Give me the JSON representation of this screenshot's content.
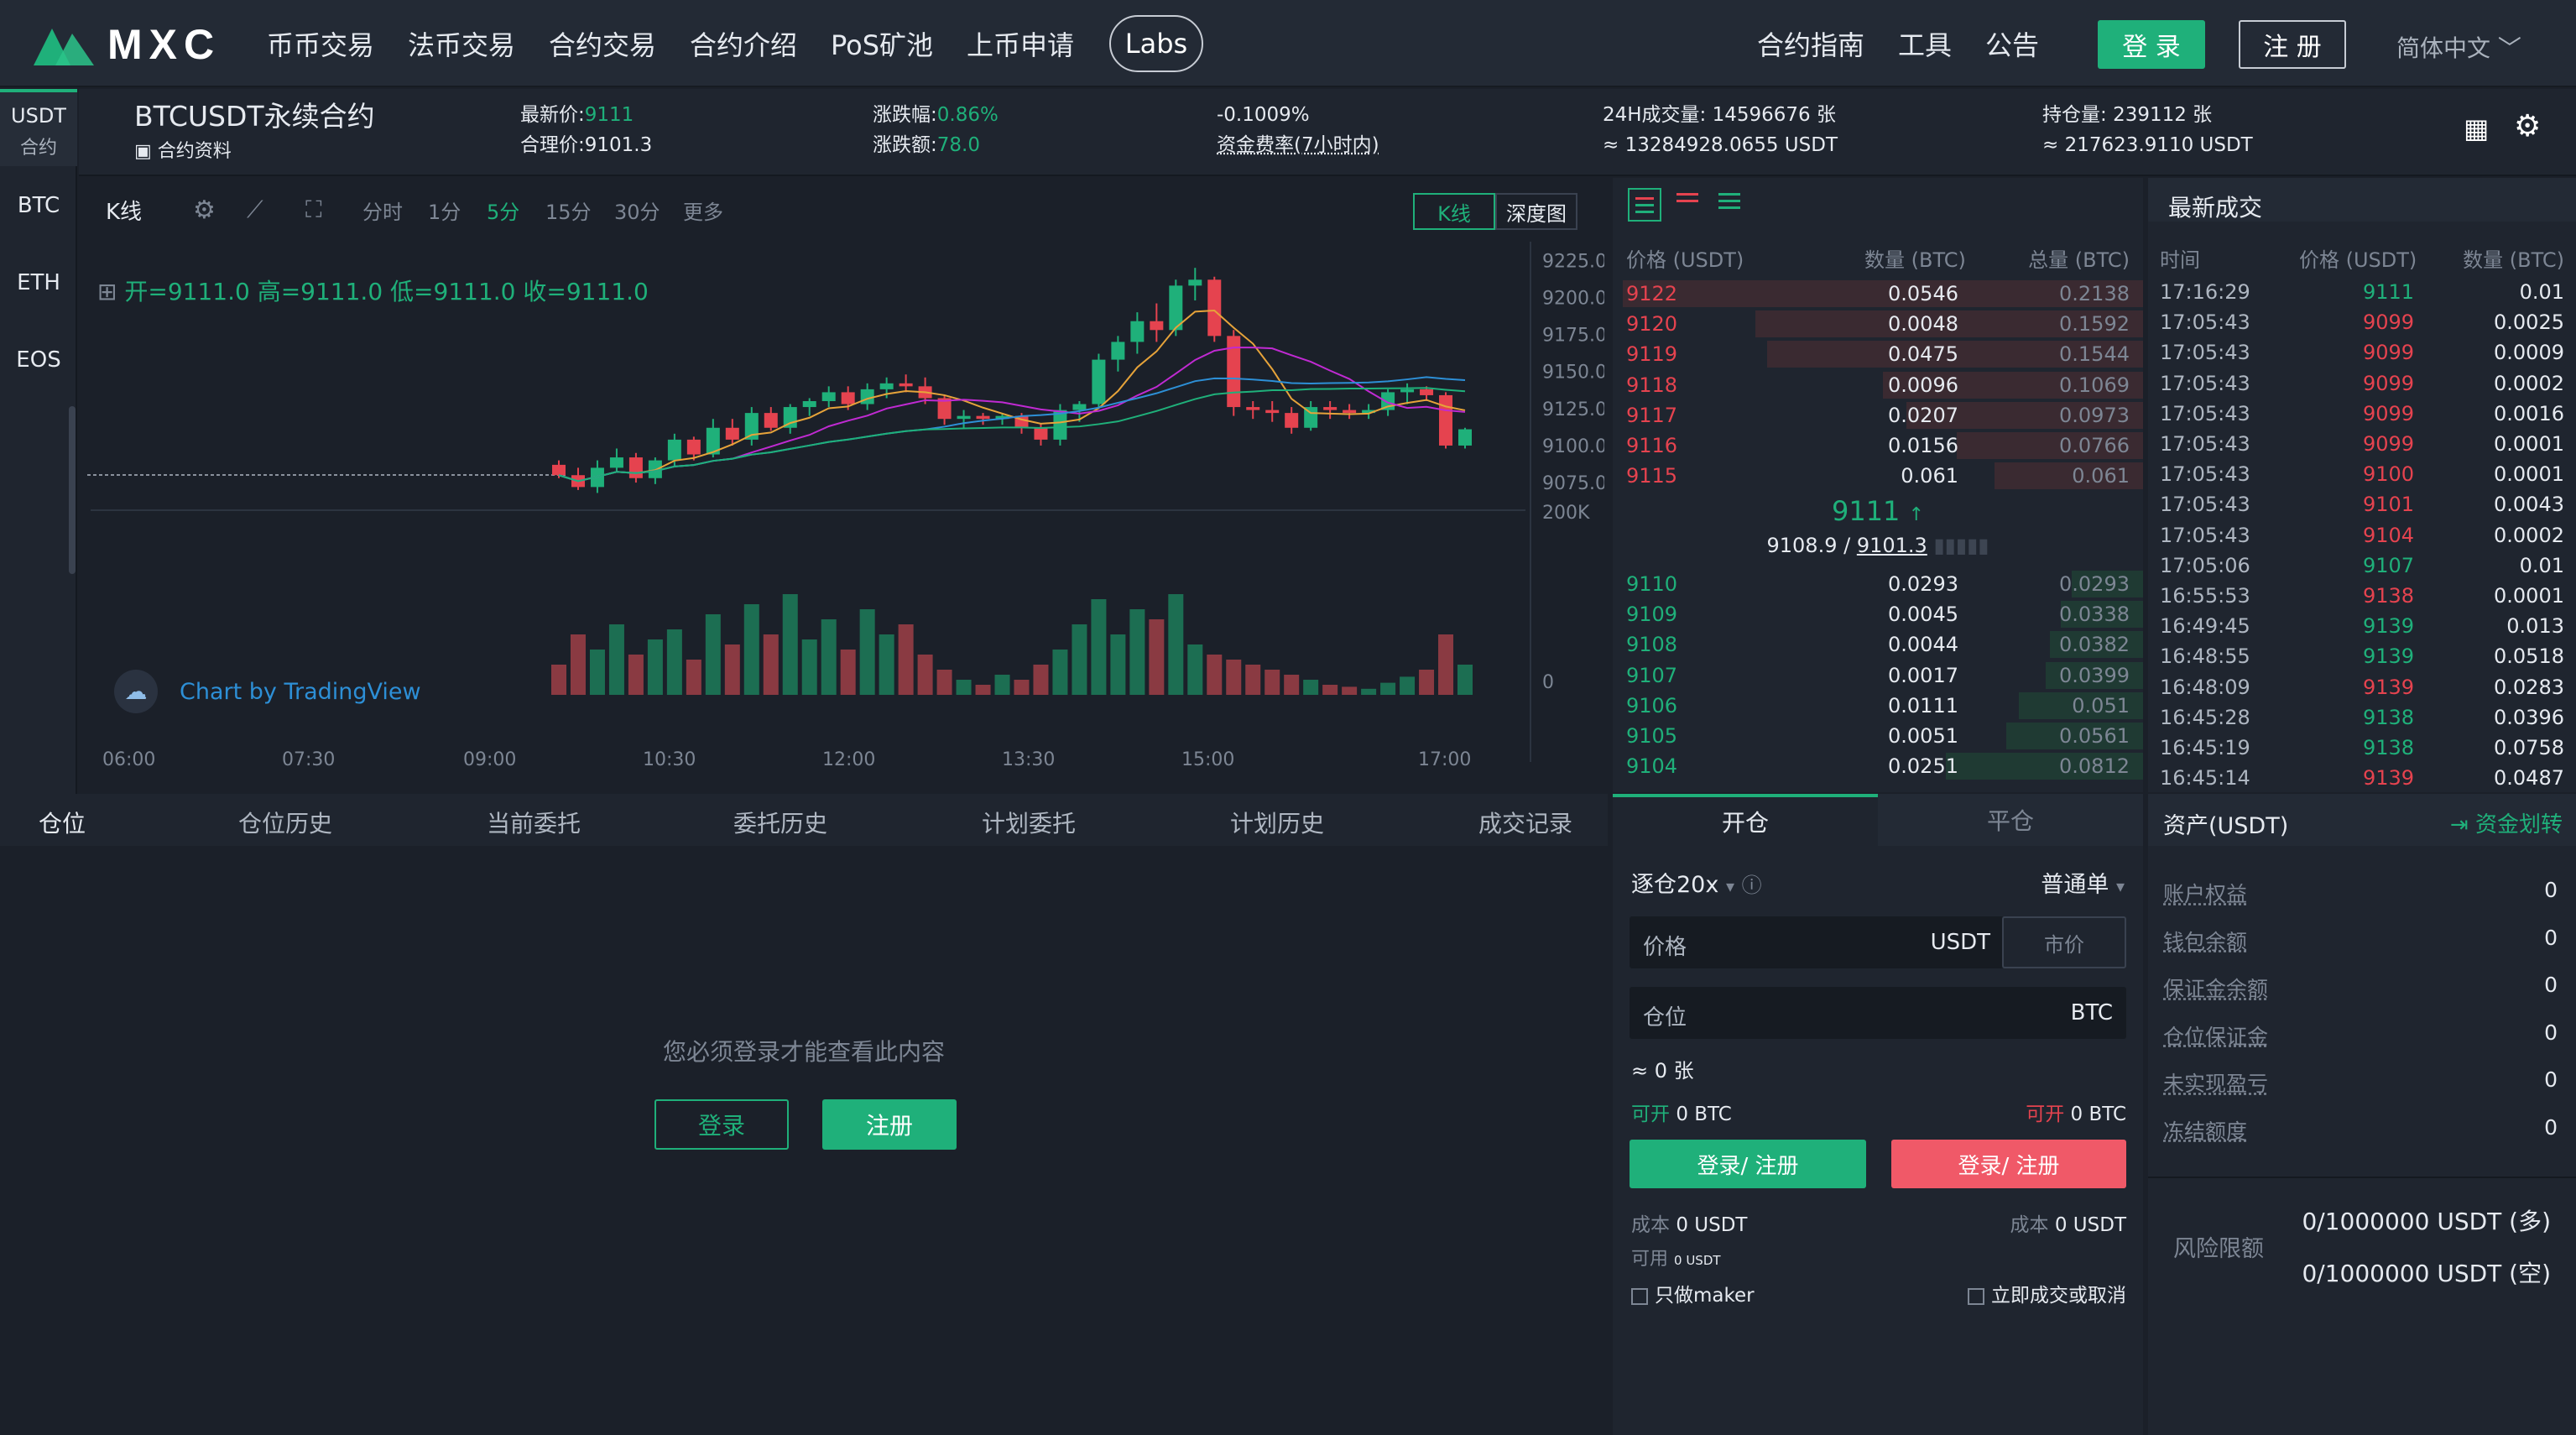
{
  "brand": {
    "name": "MXC",
    "logo_color": "#1fb07a"
  },
  "nav": {
    "items": [
      "币币交易",
      "法币交易",
      "合约交易",
      "合约介绍",
      "PoS矿池",
      "上币申请"
    ],
    "labs": "Labs",
    "right_items": [
      "合约指南",
      "工具",
      "公告"
    ],
    "login": "登 录",
    "register": "注 册",
    "language": "简体中文"
  },
  "sidebar": {
    "header_line1": "USDT",
    "header_line2": "合约",
    "coins": [
      "BTC",
      "ETH",
      "EOS"
    ],
    "active": "BTC"
  },
  "ticker": {
    "symbol": "BTCUSDT永续合约",
    "info_link": "合约资料",
    "last_price_label": "最新价:",
    "last_price": "9111",
    "fair_price_label": "合理价:",
    "fair_price": "9101.3",
    "change_pct_label": "涨跌幅:",
    "change_pct": "0.86%",
    "change_amt_label": "涨跌额:",
    "change_amt": "78.0",
    "funding_rate": "-0.1009%",
    "funding_label": "资金费率(7小时内)",
    "volume_label": "24H成交量:",
    "volume": "14596676 张",
    "volume_usdt": "≈ 13284928.0655 USDT",
    "open_interest_label": "持仓量:",
    "open_interest": "239112 张",
    "open_interest_usdt": "≈ 217623.9110 USDT"
  },
  "chart_toolbar": {
    "title": "K线",
    "intervals": [
      "分时",
      "1分",
      "5分",
      "15分",
      "30分",
      "更多"
    ],
    "active_interval": "5分",
    "view_kline": "K线",
    "view_depth": "深度图"
  },
  "chart_data": {
    "type": "candlestick",
    "ohlc_legend": "开=9111.0  高=9111.0  低=9111.0  收=9111.0",
    "watermark": "Chart by TradingView",
    "y_ticks": [
      "9225.0",
      "9200.0",
      "9175.0",
      "9150.0",
      "9125.0",
      "9100.0",
      "9075.0"
    ],
    "ylim": [
      9062,
      9232
    ],
    "volume_ticks": [
      "200K",
      "0"
    ],
    "x_ticks": [
      "06:00",
      "07:30",
      "09:00",
      "10:30",
      "12:00",
      "13:30",
      "15:00",
      "17:00"
    ],
    "candles": [
      [
        9087,
        9090,
        9078,
        9080
      ],
      [
        9080,
        9085,
        9070,
        9072
      ],
      [
        9072,
        9090,
        9068,
        9085
      ],
      [
        9085,
        9098,
        9082,
        9092
      ],
      [
        9092,
        9095,
        9075,
        9078
      ],
      [
        9078,
        9092,
        9074,
        9090
      ],
      [
        9090,
        9108,
        9086,
        9104
      ],
      [
        9104,
        9106,
        9090,
        9094
      ],
      [
        9094,
        9118,
        9092,
        9112
      ],
      [
        9112,
        9118,
        9100,
        9104
      ],
      [
        9104,
        9126,
        9100,
        9122
      ],
      [
        9122,
        9126,
        9110,
        9112
      ],
      [
        9112,
        9128,
        9108,
        9126
      ],
      [
        9126,
        9132,
        9120,
        9130
      ],
      [
        9130,
        9140,
        9126,
        9136
      ],
      [
        9136,
        9140,
        9124,
        9128
      ],
      [
        9128,
        9142,
        9124,
        9138
      ],
      [
        9138,
        9146,
        9132,
        9142
      ],
      [
        9142,
        9148,
        9136,
        9140
      ],
      [
        9140,
        9146,
        9128,
        9132
      ],
      [
        9132,
        9134,
        9114,
        9118
      ],
      [
        9118,
        9124,
        9112,
        9120
      ],
      [
        9120,
        9122,
        9114,
        9118
      ],
      [
        9118,
        9122,
        9114,
        9120
      ],
      [
        9120,
        9122,
        9108,
        9112
      ],
      [
        9112,
        9115,
        9100,
        9104
      ],
      [
        9104,
        9128,
        9100,
        9124
      ],
      [
        9124,
        9130,
        9116,
        9128
      ],
      [
        9128,
        9162,
        9126,
        9158
      ],
      [
        9158,
        9174,
        9150,
        9170
      ],
      [
        9170,
        9190,
        9162,
        9184
      ],
      [
        9184,
        9196,
        9170,
        9178
      ],
      [
        9178,
        9212,
        9174,
        9208
      ],
      [
        9208,
        9220,
        9198,
        9212
      ],
      [
        9212,
        9214,
        9170,
        9174
      ],
      [
        9174,
        9178,
        9120,
        9126
      ],
      [
        9126,
        9130,
        9118,
        9124
      ],
      [
        9124,
        9130,
        9116,
        9122
      ],
      [
        9122,
        9126,
        9108,
        9112
      ],
      [
        9112,
        9130,
        9110,
        9126
      ],
      [
        9126,
        9130,
        9118,
        9124
      ],
      [
        9124,
        9128,
        9118,
        9122
      ],
      [
        9122,
        9128,
        9118,
        9124
      ],
      [
        9124,
        9138,
        9120,
        9136
      ],
      [
        9136,
        9142,
        9128,
        9138
      ],
      [
        9138,
        9140,
        9130,
        9134
      ],
      [
        9134,
        9136,
        9098,
        9100
      ],
      [
        9100,
        9112,
        9098,
        9111
      ]
    ],
    "volumes": [
      30,
      60,
      45,
      70,
      40,
      55,
      65,
      35,
      80,
      50,
      90,
      60,
      100,
      55,
      75,
      45,
      85,
      60,
      70,
      40,
      25,
      15,
      10,
      20,
      15,
      30,
      45,
      70,
      95,
      60,
      85,
      75,
      100,
      50,
      40,
      35,
      30,
      25,
      20,
      15,
      10,
      8,
      6,
      12,
      18,
      25,
      60,
      30
    ],
    "ma_colors": [
      "#e6a33a",
      "#c02ad2",
      "#2d8fd6",
      "#1fb07a"
    ]
  },
  "orderbook": {
    "headers": [
      "价格 (USDT)",
      "数量 (BTC)",
      "总量 (BTC)"
    ],
    "asks": [
      [
        "9122",
        "0.0546",
        "0.2138"
      ],
      [
        "9120",
        "0.0048",
        "0.1592"
      ],
      [
        "9119",
        "0.0475",
        "0.1544"
      ],
      [
        "9118",
        "0.0096",
        "0.1069"
      ],
      [
        "9117",
        "0.0207",
        "0.0973"
      ],
      [
        "9116",
        "0.0156",
        "0.0766"
      ],
      [
        "9115",
        "0.061",
        "0.061"
      ]
    ],
    "mid_price": "9111",
    "mid_index": "9108.9",
    "mid_fair": "9101.3",
    "bids": [
      [
        "9110",
        "0.0293",
        "0.0293"
      ],
      [
        "9109",
        "0.0045",
        "0.0338"
      ],
      [
        "9108",
        "0.0044",
        "0.0382"
      ],
      [
        "9107",
        "0.0017",
        "0.0399"
      ],
      [
        "9106",
        "0.0111",
        "0.051"
      ],
      [
        "9105",
        "0.0051",
        "0.0561"
      ],
      [
        "9104",
        "0.0251",
        "0.0812"
      ]
    ]
  },
  "trades": {
    "title": "最新成交",
    "headers": [
      "时间",
      "价格 (USDT)",
      "数量 (BTC)"
    ],
    "rows": [
      [
        "17:16:29",
        "9111",
        "0.01",
        "g"
      ],
      [
        "17:05:43",
        "9099",
        "0.0025",
        "r"
      ],
      [
        "17:05:43",
        "9099",
        "0.0009",
        "r"
      ],
      [
        "17:05:43",
        "9099",
        "0.0002",
        "r"
      ],
      [
        "17:05:43",
        "9099",
        "0.0016",
        "r"
      ],
      [
        "17:05:43",
        "9099",
        "0.0001",
        "r"
      ],
      [
        "17:05:43",
        "9100",
        "0.0001",
        "r"
      ],
      [
        "17:05:43",
        "9101",
        "0.0043",
        "r"
      ],
      [
        "17:05:43",
        "9104",
        "0.0002",
        "r"
      ],
      [
        "17:05:06",
        "9107",
        "0.01",
        "g"
      ],
      [
        "16:55:53",
        "9138",
        "0.0001",
        "r"
      ],
      [
        "16:49:45",
        "9139",
        "0.013",
        "g"
      ],
      [
        "16:48:55",
        "9139",
        "0.0518",
        "g"
      ],
      [
        "16:48:09",
        "9139",
        "0.0283",
        "r"
      ],
      [
        "16:45:28",
        "9138",
        "0.0396",
        "g"
      ],
      [
        "16:45:19",
        "9138",
        "0.0758",
        "g"
      ],
      [
        "16:45:14",
        "9139",
        "0.0487",
        "r"
      ]
    ]
  },
  "positions": {
    "tabs": [
      "仓位",
      "仓位历史",
      "当前委托",
      "委托历史",
      "计划委托",
      "计划历史",
      "成交记录"
    ],
    "empty_message": "您必须登录才能查看此内容",
    "login": "登录",
    "register": "注册"
  },
  "order_form": {
    "tab_open": "开仓",
    "tab_close": "平仓",
    "leverage": "逐仓20x",
    "order_type": "普通单",
    "price_label": "价格",
    "price_unit": "USDT",
    "market_btn": "市价",
    "amount_label": "仓位",
    "amount_unit": "BTC",
    "approx": "≈ 0 张",
    "can_open_long_label": "可开",
    "can_open_long": "0 BTC",
    "can_open_short_label": "可开",
    "can_open_short": "0 BTC",
    "buy_btn": "登录/ 注册",
    "sell_btn": "登录/ 注册",
    "cost_long_label": "成本",
    "cost_long": "0 USDT",
    "cost_short_label": "成本",
    "cost_short": "0 USDT",
    "available_label": "可用",
    "available": "0 USDT",
    "maker_only": "只做maker",
    "ioc": "立即成交或取消"
  },
  "assets": {
    "title": "资产(USDT)",
    "transfer": "资金划转",
    "rows": [
      [
        "账户权益",
        "0"
      ],
      [
        "钱包余额",
        "0"
      ],
      [
        "保证金余额",
        "0"
      ],
      [
        "仓位保证金",
        "0"
      ],
      [
        "未实现盈亏",
        "0"
      ],
      [
        "冻结额度",
        "0"
      ]
    ],
    "risk_label": "风险限额",
    "risk_long": "0/1000000 USDT (多)",
    "risk_short": "0/1000000 USDT (空)"
  }
}
